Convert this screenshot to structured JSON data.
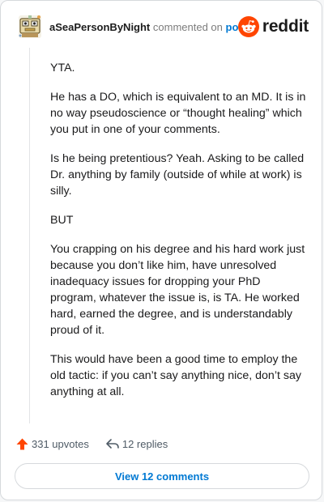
{
  "header": {
    "username": "aSeaPersonByNight",
    "action_text": "commented on",
    "post_link": "post"
  },
  "brand": {
    "wordmark": "reddit",
    "color": "#ff4500"
  },
  "comment": {
    "paragraphs": [
      "YTA.",
      "He has a DO, which is equivalent to an MD. It is in no way pseudoscience or “thought healing” which you put in one of your comments.",
      "Is he being pretentious? Yeah. Asking to be called Dr. anything by family (outside of while at work) is silly.",
      "BUT",
      "You crapping on his degree and his hard work just because you don’t like him, have unresolved inadequacy issues for dropping your PhD program, whatever the issue is, is TA. He worked hard, earned the degree, and is understandably proud of it.",
      "This would have been a good time to employ the old tactic: if you can’t say anything nice, don’t say anything at all."
    ]
  },
  "stats": {
    "upvotes": "331 upvotes",
    "replies": "12 replies",
    "upvote_icon": "upvote-arrow-icon",
    "reply_icon": "reply-arrow-icon",
    "upvote_color": "#ff4500"
  },
  "footer": {
    "view_comments": "View 12 comments"
  }
}
